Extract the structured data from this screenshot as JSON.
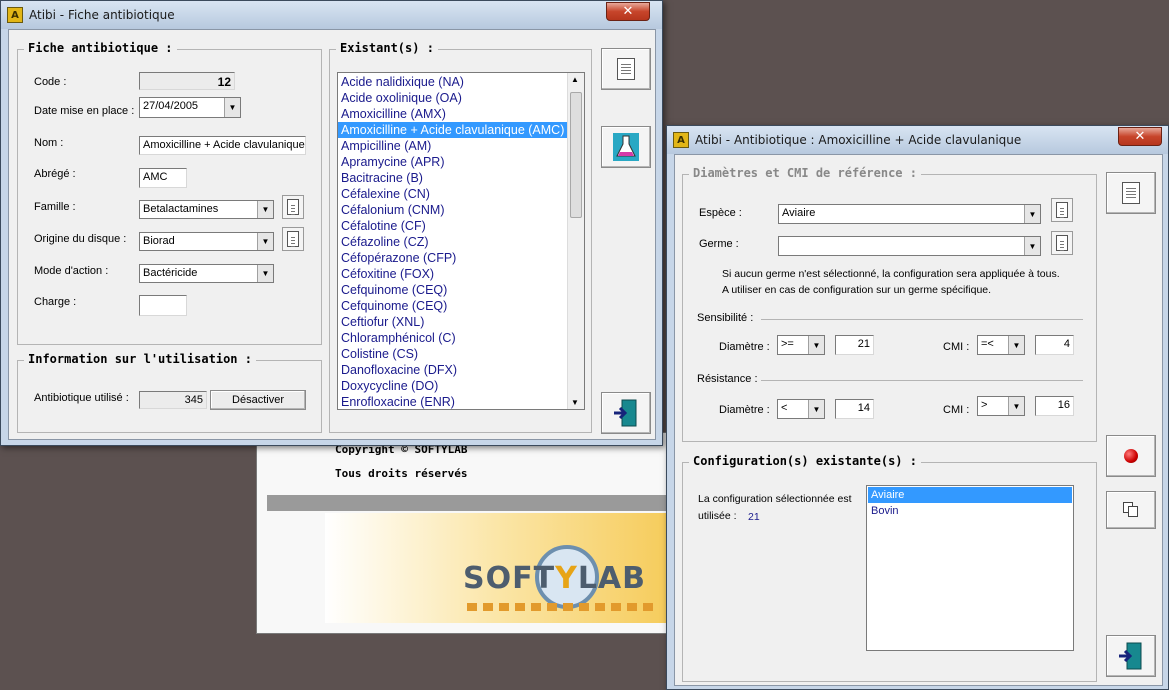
{
  "background_window": {
    "copyright": "Copyright © SOFTYLAB",
    "rights": "Tous droits réservés",
    "logo_soft": "SOFT",
    "logo_y": "Y",
    "logo_lab": "LAB"
  },
  "fiche_window": {
    "title": "Atibi - Fiche antibiotique",
    "close": "✕",
    "group_fiche": "Fiche antibiotique :",
    "code_label": "Code :",
    "code_value": "12",
    "date_label": "Date mise en place :",
    "date_value": "27/04/2005",
    "nom_label": "Nom :",
    "nom_value": "Amoxicilline + Acide clavulanique",
    "abrege_label": "Abrégé :",
    "abrege_value": "AMC",
    "famille_label": "Famille :",
    "famille_value": "Betalactamines",
    "origine_label": "Origine du disque :",
    "origine_value": "Biorad",
    "mode_label": "Mode d'action :",
    "mode_value": "Bactéricide",
    "charge_label": "Charge :",
    "charge_value": "",
    "group_info": "Information sur l'utilisation :",
    "utilise_label": "Antibiotique utilisé :",
    "utilise_value": "345",
    "desactiver": "Désactiver",
    "group_existants": "Existant(s) :",
    "existants": [
      "Acide nalidixique (NA)",
      "Acide oxolinique (OA)",
      "Amoxicilline (AMX)",
      "Amoxicilline + Acide clavulanique (AMC)",
      "Ampicilline (AM)",
      "Apramycine (APR)",
      "Bacitracine (B)",
      "Céfalexine (CN)",
      "Céfalonium (CNM)",
      "Céfalotine (CF)",
      "Céfazoline (CZ)",
      "Céfopérazone (CFP)",
      "Céfoxitine (FOX)",
      "Cefquinome (CEQ)",
      "Cefquinome (CEQ)",
      "Ceftiofur (XNL)",
      "Chloramphénicol (C)",
      "Colistine (CS)",
      "Danofloxacine (DFX)",
      "Doxycycline (DO)",
      "Enrofloxacine (ENR)"
    ],
    "selected_index": 3
  },
  "antibio_window": {
    "title": "Atibi -  Antibiotique : Amoxicilline + Acide clavulanique",
    "close": "✕",
    "group_diam": "Diamètres et CMI de référence :",
    "espece_label": "Espèce :",
    "espece_value": "Aviaire",
    "germe_label": "Germe :",
    "germe_value": "",
    "info_line1": "Si aucun germe n'est sélectionné, la configuration sera appliquée à tous.",
    "info_line2": "A utiliser en cas de configuration sur un germe spécifique.",
    "sensibilite_label": "Sensibilité :",
    "sens_diametre_label": "Diamètre :",
    "sens_diametre_op": ">=",
    "sens_diametre_value": "21",
    "sens_cmi_label": "CMI :",
    "sens_cmi_op": "=<",
    "sens_cmi_value": "4",
    "resistance_label": "Résistance :",
    "res_diametre_label": "Diamètre :",
    "res_diametre_op": "<",
    "res_diametre_value": "14",
    "res_cmi_label": "CMI :",
    "res_cmi_op": ">",
    "res_cmi_value": "16",
    "group_config": "Configuration(s) existante(s) :",
    "config_text1": "La configuration sélectionnée est",
    "config_text2": "utilisée :",
    "config_count": "21",
    "configs": [
      "Aviaire",
      "Bovin"
    ]
  }
}
